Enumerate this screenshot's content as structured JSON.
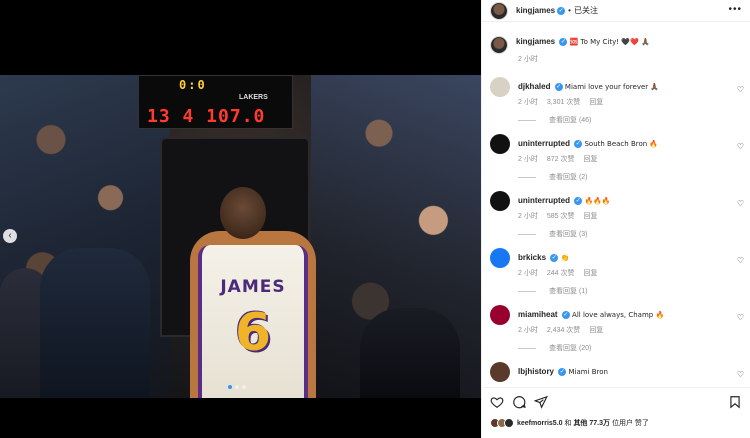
{
  "scoreboard": {
    "top": "0:0",
    "team": "LAKERS",
    "bottom": "13 4 107.0"
  },
  "jersey": {
    "name": "JAMES",
    "number": "6"
  },
  "carousel": {
    "prev_icon": "‹",
    "dots": 3,
    "active_index": 0
  },
  "post": {
    "username": "kingjames",
    "verified_icon": "✓",
    "separator": "•",
    "follow_status": "已关注",
    "more_icon": "•••"
  },
  "caption": {
    "username": "kingjames",
    "text": "🆘 To My City! 🖤❤️ 🙏🏾",
    "time": "2 小时"
  },
  "comments": [
    {
      "username": "djkhaled",
      "text": "Miami love your forever 🙏🏾",
      "time": "2 小时",
      "likes": "3,301 次赞",
      "reply": "回复",
      "view_replies": "查看回复 (46)",
      "avatar_color": "#d8d2c4"
    },
    {
      "username": "uninterrupted",
      "text": "South Beach Bron 🔥",
      "time": "2 小时",
      "likes": "872 次赞",
      "reply": "回复",
      "view_replies": "查看回复 (2)",
      "avatar_color": "#111111"
    },
    {
      "username": "uninterrupted",
      "text": "🔥🔥🔥",
      "time": "2 小时",
      "likes": "585 次赞",
      "reply": "回复",
      "view_replies": "查看回复 (3)",
      "avatar_color": "#111111"
    },
    {
      "username": "brkicks",
      "text": "👏",
      "time": "2 小时",
      "likes": "244 次赞",
      "reply": "回复",
      "view_replies": "查看回复 (1)",
      "avatar_color": "#1877f2"
    },
    {
      "username": "miamiheat",
      "text": "All love always, Champ 🔥",
      "time": "2 小时",
      "likes": "2,434 次赞",
      "reply": "回复",
      "view_replies": "查看回复 (20)",
      "avatar_color": "#98002e"
    },
    {
      "username": "lbjhistory",
      "text": "Miami Bron",
      "time": "",
      "likes": "",
      "reply": "",
      "view_replies": "",
      "avatar_color": "#5a3a2a"
    }
  ],
  "heart_icon": "♡",
  "actions": {
    "like_icon": "heart-outline-icon",
    "comment_icon": "comment-icon",
    "share_icon": "paper-plane-icon",
    "save_icon": "bookmark-icon"
  },
  "likes": {
    "first_user": "keefmorris5.0",
    "connector": "和",
    "others_label": "其他",
    "count": "77.3万",
    "suffix": "位用户 赞了"
  }
}
